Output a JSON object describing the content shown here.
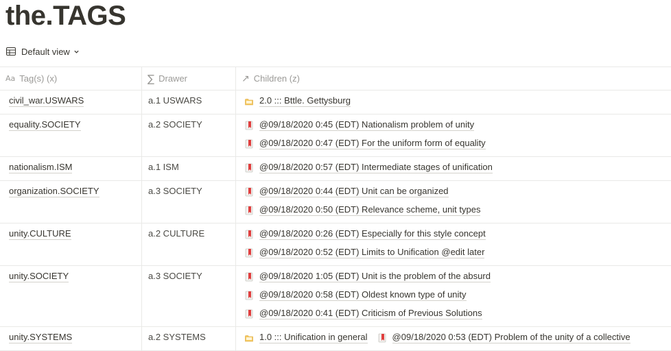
{
  "page": {
    "title": "the.TAGS"
  },
  "view": {
    "label": "Default view",
    "icon": "table-icon",
    "chevron": "chevron-down-icon"
  },
  "columns": [
    {
      "label": "Tag(s) (x)",
      "icon": "text-property-icon"
    },
    {
      "label": "Drawer",
      "icon": "sigma-formula-icon"
    },
    {
      "label": "Children (z)",
      "icon": "relation-arrow-icon"
    }
  ],
  "rows": [
    {
      "tag": "civil_war.USWARS",
      "drawer": "a.1 USWARS",
      "children": [
        [
          {
            "text": "2.0 ::: Bttle. Gettysburg",
            "icon": "folder-icon"
          }
        ]
      ]
    },
    {
      "tag": "equality.SOCIETY",
      "drawer": "a.2 SOCIETY",
      "children": [
        [
          {
            "text": "@09/18/2020 0:45 (EDT) Nationalism problem of unity",
            "icon": "bookmark-icon"
          }
        ],
        [
          {
            "text": "@09/18/2020 0:47 (EDT) For the uniform form of equality",
            "icon": "bookmark-icon"
          }
        ]
      ]
    },
    {
      "tag": "nationalism.ISM",
      "drawer": "a.1 ISM",
      "children": [
        [
          {
            "text": "@09/18/2020 0:57 (EDT) Intermediate stages of unification",
            "icon": "bookmark-icon"
          }
        ]
      ]
    },
    {
      "tag": "organization.SOCIETY",
      "drawer": "a.3 SOCIETY",
      "children": [
        [
          {
            "text": "@09/18/2020 0:44 (EDT) Unit can be organized",
            "icon": "bookmark-icon"
          }
        ],
        [
          {
            "text": "@09/18/2020 0:50 (EDT) Relevance scheme, unit types",
            "icon": "bookmark-icon"
          }
        ]
      ]
    },
    {
      "tag": "unity.CULTURE",
      "drawer": "a.2 CULTURE",
      "children": [
        [
          {
            "text": "@09/18/2020 0:26 (EDT) Especially for this style concept",
            "icon": "bookmark-icon"
          }
        ],
        [
          {
            "text": "@09/18/2020 0:52 (EDT) Limits to Unification @edit later",
            "icon": "bookmark-icon"
          }
        ]
      ]
    },
    {
      "tag": "unity.SOCIETY",
      "drawer": "a.3 SOCIETY",
      "children": [
        [
          {
            "text": "@09/18/2020 1:05 (EDT) Unit is the problem of the absurd",
            "icon": "bookmark-icon"
          }
        ],
        [
          {
            "text": "@09/18/2020 0:58 (EDT) Oldest known type of unity",
            "icon": "bookmark-icon"
          }
        ],
        [
          {
            "text": "@09/18/2020 0:41 (EDT) Criticism of Previous Solutions",
            "icon": "bookmark-icon"
          }
        ]
      ]
    },
    {
      "tag": "unity.SYSTEMS",
      "drawer": "a.2 SYSTEMS",
      "children": [
        [
          {
            "text": "1.0 ::: Unification in general",
            "icon": "folder-icon"
          },
          {
            "text": "@09/18/2020 0:53 (EDT) Problem of the unity of a collective",
            "icon": "bookmark-icon"
          }
        ]
      ]
    }
  ],
  "colors": {
    "text": "#37352f",
    "muted": "#9b9a97",
    "border": "#e9e9e7",
    "bookmark_red": "#e03e3e",
    "folder_yellow": "#f5c85e"
  }
}
